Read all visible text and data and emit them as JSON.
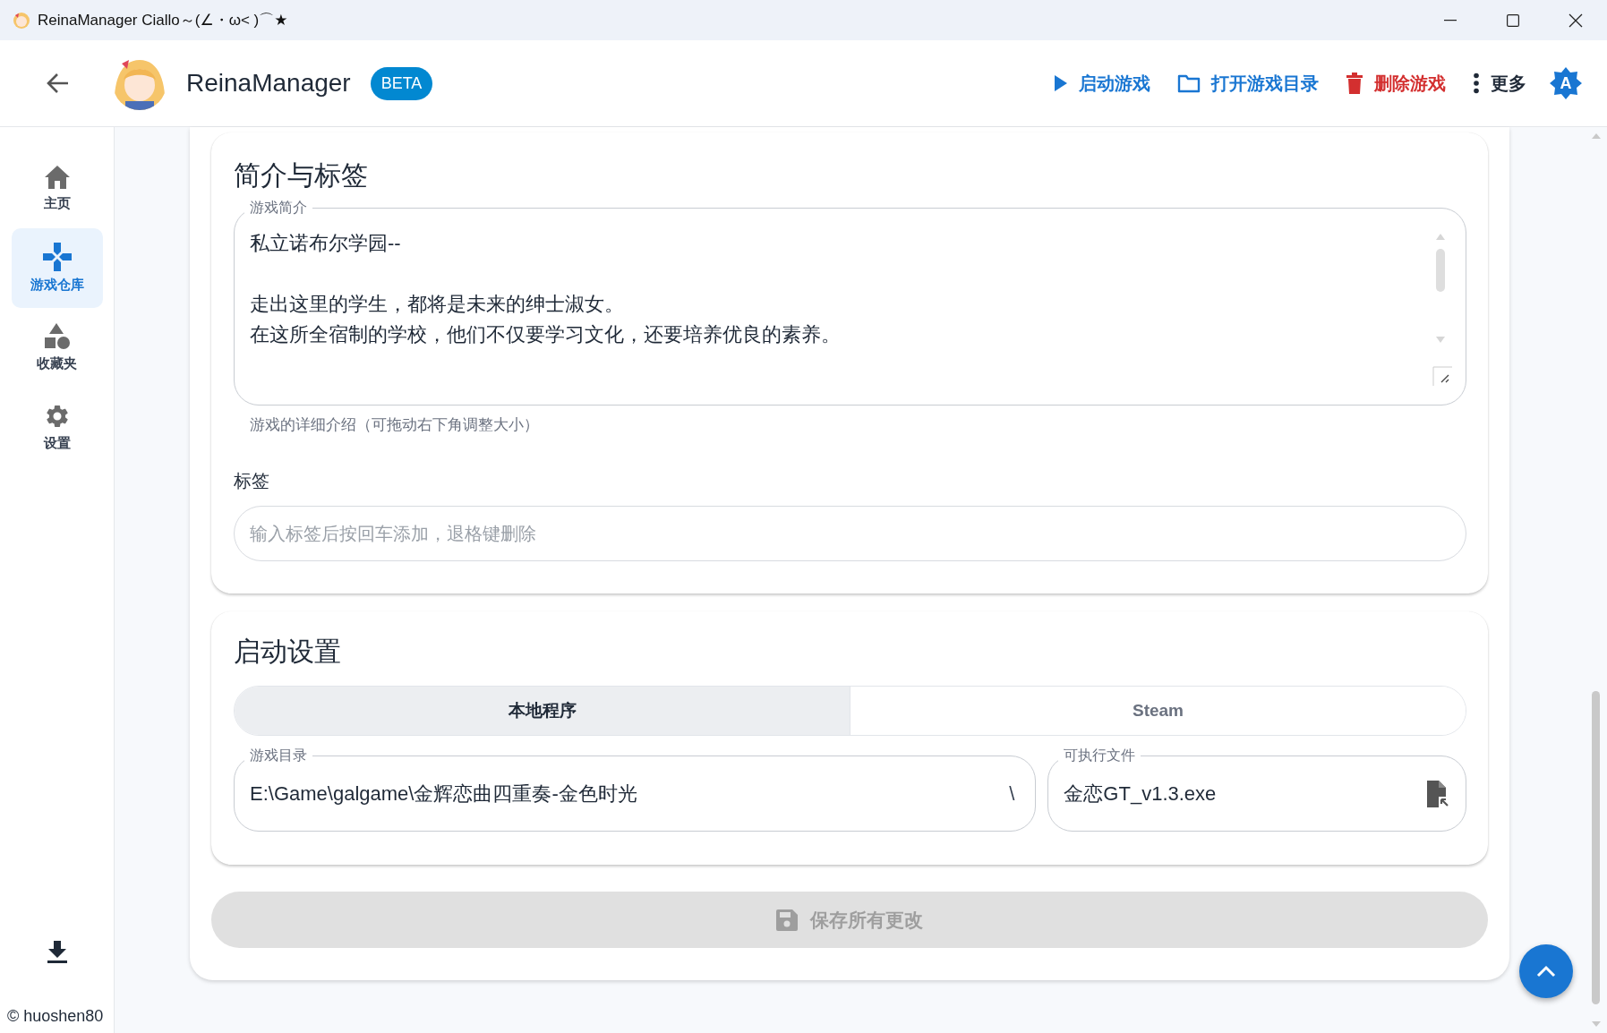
{
  "window": {
    "title": "ReinaManager Ciallo～(∠・ω< )⌒★"
  },
  "header": {
    "app_name": "ReinaManager",
    "badge": "BETA",
    "actions": [
      {
        "kind": "play",
        "label": "启动游戏"
      },
      {
        "kind": "folder",
        "label": "打开游戏目录"
      },
      {
        "kind": "delete",
        "label": "删除游戏"
      },
      {
        "kind": "more",
        "label": "更多"
      }
    ],
    "account": "A"
  },
  "sidebar": {
    "items": [
      {
        "kind": "home",
        "label": "主页",
        "selected": false
      },
      {
        "kind": "games",
        "label": "游戏仓库",
        "selected": true
      },
      {
        "kind": "collections",
        "label": "收藏夹",
        "selected": false
      },
      {
        "kind": "settings",
        "label": "设置",
        "selected": false
      }
    ],
    "copyright": "© huoshen80"
  },
  "intro_section": {
    "title": "简介与标签",
    "description": {
      "label": "游戏简介",
      "paragraphs": [
        [
          "私立诺布尔学园--"
        ],
        [
          "走出这里的学生，都将是未来的绅士淑女。",
          "在这所全宿制的学校，他们不仅要学习文化，还要培养优良的素养。"
        ]
      ],
      "helper": "游戏的详细介绍（可拖动右下角调整大小）"
    },
    "tags": {
      "label": "标签",
      "placeholder": "输入标签后按回车添加，退格键删除"
    }
  },
  "launch_section": {
    "title": "启动设置",
    "modes": [
      {
        "label": "本地程序",
        "selected": true
      },
      {
        "label": "Steam",
        "selected": false
      }
    ],
    "fields": [
      {
        "kind": "directory",
        "label": "游戏目录",
        "value": "E:\\Game\\galgame\\金辉恋曲四重奏-金色时光",
        "adornment": "\\"
      },
      {
        "kind": "executable",
        "label": "可执行文件",
        "value": "金恋GT_v1.3.exe"
      }
    ]
  },
  "save_button": {
    "label": "保存所有更改",
    "disabled": true
  }
}
